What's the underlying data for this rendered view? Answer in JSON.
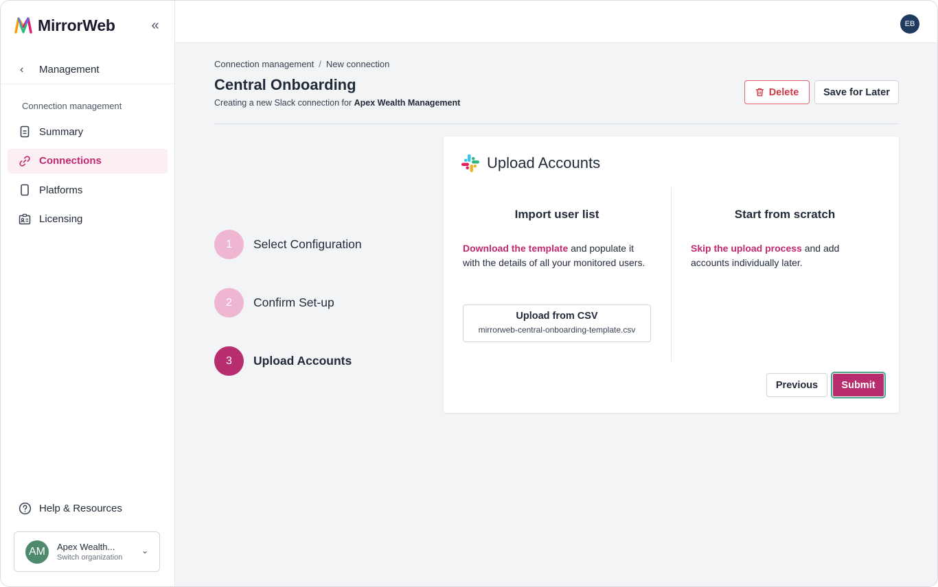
{
  "brand": {
    "name": "MirrorWeb",
    "collapse_icon": "«"
  },
  "sidebar": {
    "back": {
      "chevron": "‹",
      "label": "Management"
    },
    "section_label": "Connection management",
    "items": [
      {
        "label": "Summary",
        "icon": "document-icon",
        "active": false
      },
      {
        "label": "Connections",
        "icon": "link-icon",
        "active": true
      },
      {
        "label": "Platforms",
        "icon": "device-icon",
        "active": false
      },
      {
        "label": "Licensing",
        "icon": "id-card-icon",
        "active": false
      }
    ],
    "help_label": "Help & Resources",
    "org": {
      "initials": "AM",
      "name": "Apex Wealth...",
      "sub": "Switch organization",
      "chevron": "⌄"
    }
  },
  "topbar": {
    "user_initials": "EB"
  },
  "header": {
    "breadcrumb": [
      "Connection management",
      "New connection"
    ],
    "breadcrumb_sep": "/",
    "title": "Central Onboarding",
    "subtitle_prefix": "Creating a new Slack connection for ",
    "subtitle_org": "Apex Wealth Management",
    "delete_label": "Delete",
    "save_label": "Save for Later"
  },
  "steps": [
    {
      "num": "1",
      "label": "Select Configuration"
    },
    {
      "num": "2",
      "label": "Confirm Set-up"
    },
    {
      "num": "3",
      "label": "Upload Accounts"
    }
  ],
  "card": {
    "title": "Upload Accounts",
    "import": {
      "heading": "Import user list",
      "link": "Download the template",
      "text": " and populate it with the details of all your monitored users.",
      "upload_title": "Upload from CSV",
      "upload_file": "mirrorweb-central-onboarding-template.csv"
    },
    "scratch": {
      "heading": "Start from scratch",
      "link": "Skip the upload process",
      "text": " and add accounts individually later."
    },
    "previous_label": "Previous",
    "submit_label": "Submit"
  },
  "colors": {
    "accent": "#c2286e",
    "step_done": "#efb6d2",
    "step_current": "#b72d6e",
    "delete": "#d13b45"
  }
}
